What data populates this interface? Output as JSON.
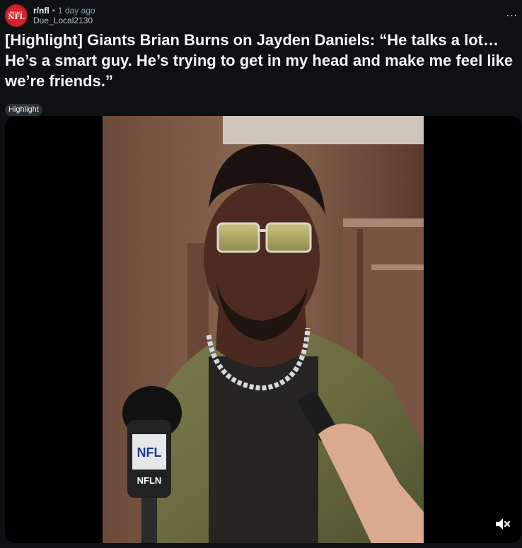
{
  "post": {
    "subreddit": "r/nfl",
    "separator": "•",
    "age": "1 day ago",
    "author": "Due_Local2130",
    "title": "[Highlight] Giants Brian Burns on Jayden Daniels: “He talks a lot… He’s a smart guy. He’s trying to get in my head and make me feel like we’re friends.”",
    "flair": "Highlight",
    "more_label": "...",
    "avatar": {
      "top_text": "REDDIT",
      "main_text": "NFL",
      "color": "#d4232a"
    }
  },
  "media": {
    "mic_logo_text": "NFL",
    "mic_brand_text": "NFLN",
    "mute_icon": "speaker-muted-icon"
  },
  "colors": {
    "background": "#0e1113",
    "text": "#f2f4f5",
    "muted_text": "#8ba2ad",
    "flair_bg": "#2a3236",
    "video_bg": "#000000"
  }
}
